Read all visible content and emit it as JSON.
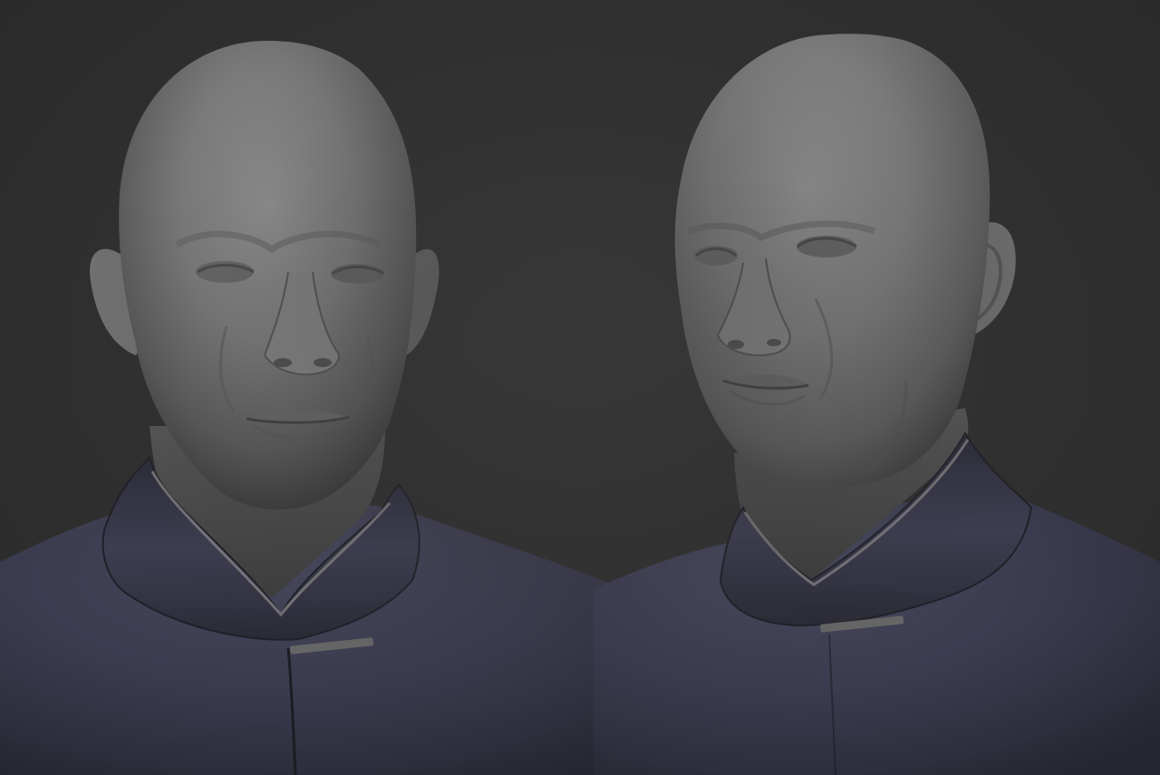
{
  "scene": {
    "kind": "3d-sculpt-render",
    "background_color": "#2f2f2f",
    "skin_color": "#8d8d8d",
    "jacket_color": "#3b3b4f",
    "collar_trim_color": "#9a9a9a",
    "buttons": [
      "clasp-left-view",
      "clasp-right-view"
    ]
  },
  "views": [
    {
      "id": "front-view",
      "orientation": "front"
    },
    {
      "id": "three-quarter-view",
      "orientation": "three-quarter-left"
    }
  ]
}
